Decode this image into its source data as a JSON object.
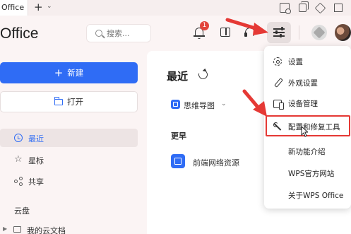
{
  "titlebar": {
    "tab_label": "Office",
    "new_tab_symbol": "+",
    "tab_menu_symbol": "⌄",
    "window_icons": [
      "screen-record-icon",
      "restore-icon",
      "cube-icon",
      "maximize-icon"
    ]
  },
  "header": {
    "app_title": "Office",
    "search_placeholder": "搜索...",
    "notification_count": "1",
    "icons": [
      "bell-icon",
      "panel-icon",
      "headset-icon",
      "settings-sliders-icon",
      "wps-icon",
      "avatar"
    ]
  },
  "sidebar": {
    "new_button": "新建",
    "new_symbol": "+",
    "open_button": "打开",
    "nav": [
      {
        "label": "最近",
        "icon": "clock-icon",
        "active": true
      },
      {
        "label": "星标",
        "icon": "star-icon",
        "active": false
      },
      {
        "label": "共享",
        "icon": "share-icon",
        "active": false
      }
    ],
    "cloud_section_title": "云盘",
    "cloud_items": [
      {
        "label": "我的云文档",
        "icon": "folder-icon"
      }
    ]
  },
  "main": {
    "title": "最近",
    "filter_label": "思维导图",
    "group_title": "更早",
    "files": [
      {
        "name": "前端网络资源",
        "icon": "mindmap-icon"
      }
    ]
  },
  "menu": {
    "items": [
      {
        "label": "设置",
        "icon": "gear-icon"
      },
      {
        "label": "外观设置",
        "icon": "brush-icon"
      },
      {
        "label": "设备管理",
        "icon": "devices-icon"
      },
      {
        "label": "配置和修复工具",
        "icon": "wrench-icon"
      },
      {
        "label": "新功能介绍",
        "icon": ""
      },
      {
        "label": "WPS官方网站",
        "icon": ""
      },
      {
        "label": "关于WPS Office",
        "icon": ""
      }
    ]
  },
  "colors": {
    "accent": "#2f6cf5",
    "annotation": "#e53935",
    "badge": "#e2453c"
  }
}
